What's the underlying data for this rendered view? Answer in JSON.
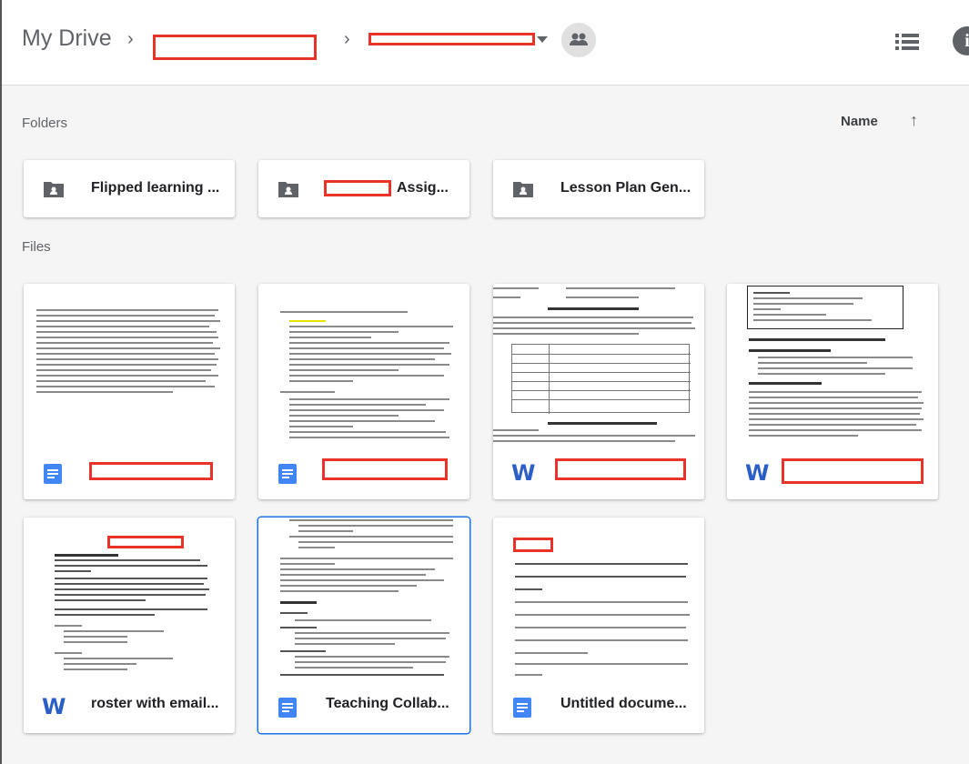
{
  "breadcrumb": {
    "root": "My Drive",
    "separator": "›"
  },
  "header": {
    "shared_icon": "people-icon",
    "list_icon": "list-view-icon",
    "info_label": "i"
  },
  "folders_section": {
    "label": "Folders",
    "sort_label": "Name",
    "sort_arrow": "↑"
  },
  "folders": [
    {
      "name": "Flipped learning ..."
    },
    {
      "name": "Assig..."
    },
    {
      "name": "Lesson Plan Gen..."
    }
  ],
  "files_section": {
    "label": "Files"
  },
  "files": [
    {
      "type": "doc",
      "name": ""
    },
    {
      "type": "doc",
      "name": ""
    },
    {
      "type": "word",
      "name": ""
    },
    {
      "type": "word",
      "name": ""
    },
    {
      "type": "word",
      "name": "roster with email..."
    },
    {
      "type": "doc",
      "name": "Teaching Collab..."
    },
    {
      "type": "doc",
      "name": "Untitled docume..."
    }
  ],
  "colors": {
    "redaction": "#e8332a",
    "doc_blue": "#4285f4",
    "word_blue": "#2b5fc7",
    "selected": "#1a73e8"
  }
}
